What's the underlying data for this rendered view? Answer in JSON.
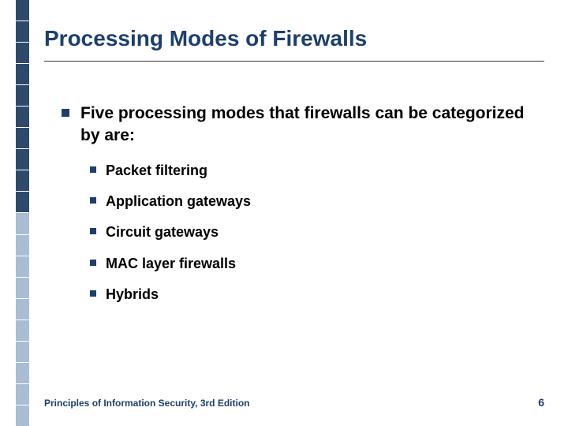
{
  "title": "Processing Modes of Firewalls",
  "main_bullet": "Five processing modes that firewalls can be categorized by are:",
  "sub_bullets": {
    "b0": "Packet filtering",
    "b1": "Application gateways",
    "b2": "Circuit gateways",
    "b3": "MAC layer firewalls",
    "b4": "Hybrids"
  },
  "footer": {
    "source": "Principles of Information Security, 3rd Edition",
    "page": "6"
  },
  "colors": {
    "accent_dark": "#1d3f6b",
    "accent_light": "#a9bdd3"
  }
}
